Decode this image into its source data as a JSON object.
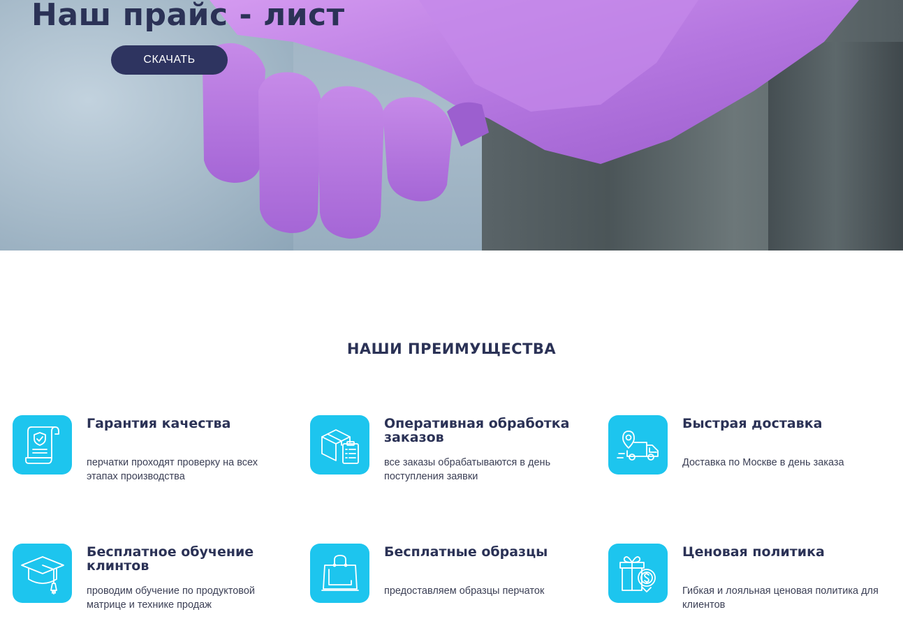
{
  "hero": {
    "title": "Наш прайс - лист",
    "download_label": "СКАЧАТЬ"
  },
  "advantages": {
    "title": "НАШИ ПРЕИМУЩЕСТВА",
    "items": [
      {
        "title": "Гарантия качества",
        "desc": "перчатки проходят проверку на всех этапах производства",
        "icon": "certificate-icon"
      },
      {
        "title": "Оперативная обработка заказов",
        "desc": "все заказы обрабатываются в день поступления заявки",
        "icon": "box-checklist-icon"
      },
      {
        "title": "Быстрая доставка",
        "desc": "Доставка по Москве в день заказа",
        "icon": "delivery-truck-icon"
      },
      {
        "title": "Бесплатное обучение клинтов",
        "desc": "проводим обучение по продуктовой матрице и технике продаж",
        "icon": "graduation-cap-icon"
      },
      {
        "title": "Бесплатные образцы",
        "desc": "предоставляем образцы перчаток",
        "icon": "shopping-bag-icon"
      },
      {
        "title": "Ценовая политика",
        "desc": "Гибкая и лояльная ценовая политика для клиентов",
        "icon": "gift-price-icon"
      }
    ]
  },
  "colors": {
    "accent": "#1dc5ee",
    "navy": "#2b3256",
    "button": "#2e3460"
  }
}
